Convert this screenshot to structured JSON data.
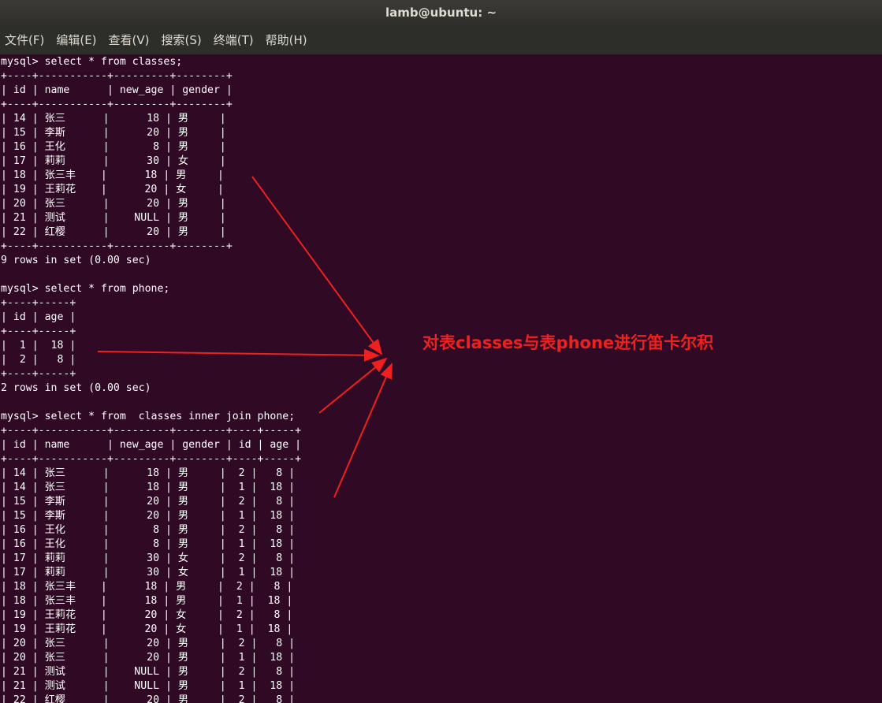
{
  "window": {
    "title": "lamb@ubuntu: ~"
  },
  "menu": [
    "文件(F)",
    "编辑(E)",
    "查看(V)",
    "搜索(S)",
    "终端(T)",
    "帮助(H)"
  ],
  "terminal": {
    "lines": [
      "mysql> select * from classes;",
      "+----+-----------+---------+--------+",
      "| id | name      | new_age | gender |",
      "+----+-----------+---------+--------+",
      "| 14 | 张三      |      18 | 男     |",
      "| 15 | 李斯      |      20 | 男     |",
      "| 16 | 王化      |       8 | 男     |",
      "| 17 | 莉莉      |      30 | 女     |",
      "| 18 | 张三丰    |      18 | 男     |",
      "| 19 | 王莉花    |      20 | 女     |",
      "| 20 | 张三      |      20 | 男     |",
      "| 21 | 测试      |    NULL | 男     |",
      "| 22 | 红樱      |      20 | 男     |",
      "+----+-----------+---------+--------+",
      "9 rows in set (0.00 sec)",
      "",
      "mysql> select * from phone;",
      "+----+-----+",
      "| id | age |",
      "+----+-----+",
      "|  1 |  18 |",
      "|  2 |   8 |",
      "+----+-----+",
      "2 rows in set (0.00 sec)",
      "",
      "mysql> select * from  classes inner join phone;",
      "+----+-----------+---------+--------+----+-----+",
      "| id | name      | new_age | gender | id | age |",
      "+----+-----------+---------+--------+----+-----+",
      "| 14 | 张三      |      18 | 男     |  2 |   8 |",
      "| 14 | 张三      |      18 | 男     |  1 |  18 |",
      "| 15 | 李斯      |      20 | 男     |  2 |   8 |",
      "| 15 | 李斯      |      20 | 男     |  1 |  18 |",
      "| 16 | 王化      |       8 | 男     |  2 |   8 |",
      "| 16 | 王化      |       8 | 男     |  1 |  18 |",
      "| 17 | 莉莉      |      30 | 女     |  2 |   8 |",
      "| 17 | 莉莉      |      30 | 女     |  1 |  18 |",
      "| 18 | 张三丰    |      18 | 男     |  2 |   8 |",
      "| 18 | 张三丰    |      18 | 男     |  1 |  18 |",
      "| 19 | 王莉花    |      20 | 女     |  2 |   8 |",
      "| 19 | 王莉花    |      20 | 女     |  1 |  18 |",
      "| 20 | 张三      |      20 | 男     |  2 |   8 |",
      "| 20 | 张三      |      20 | 男     |  1 |  18 |",
      "| 21 | 测试      |    NULL | 男     |  2 |   8 |",
      "| 21 | 测试      |    NULL | 男     |  1 |  18 |",
      "| 22 | 红樱      |      20 | 男     |  2 |   8 |"
    ]
  },
  "annotation": {
    "text": "对表classes与表phone进行笛卡尔积",
    "color": "#ee2020"
  }
}
